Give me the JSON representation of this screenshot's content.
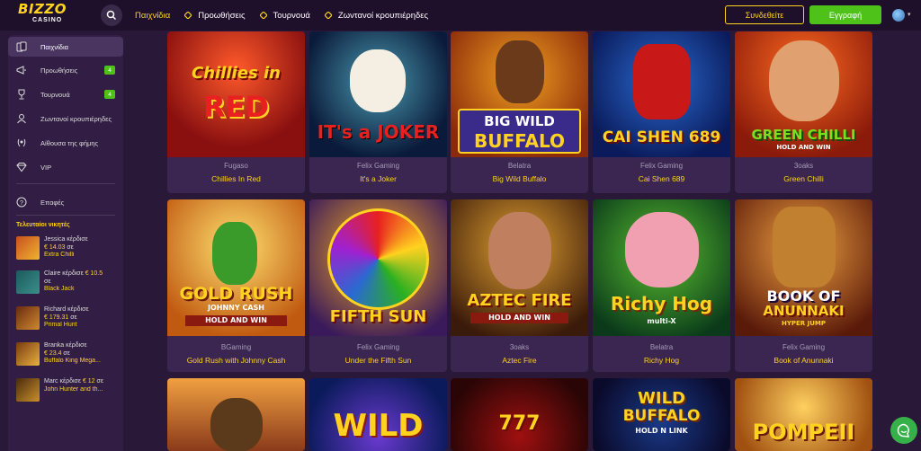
{
  "header": {
    "logo_top": "BIZZO",
    "logo_bottom": "CASINO",
    "nav": [
      "Παιχνίδια",
      "Προωθήσεις",
      "Τουρνουά",
      "Ζωντανοί κρουπιέρηδες"
    ],
    "login_label": "Συνδεθείτε",
    "register_label": "Εγγραφή"
  },
  "sidebar": {
    "items": [
      {
        "label": "Παιχνίδια",
        "icon": "cards-icon"
      },
      {
        "label": "Προωθήσεις",
        "icon": "megaphone-icon",
        "badge": "4"
      },
      {
        "label": "Τουρνουά",
        "icon": "trophy-icon",
        "badge": "4"
      },
      {
        "label": "Ζωντανοί κρουπιέρηδες",
        "icon": "dealer-icon"
      },
      {
        "label": "Αίθουσα της φήμης",
        "icon": "laurel-icon"
      },
      {
        "label": "VIP",
        "icon": "diamond-icon"
      },
      {
        "label": "Επαφές",
        "icon": "help-icon"
      }
    ],
    "winners_title": "Τελευταίοι νικητές",
    "winners": [
      {
        "line1": "Jessica κέρδισε",
        "amount": "€ 14.03",
        "suffix": "σε",
        "game": "Extra Chilli"
      },
      {
        "line1": "Claire κέρδισε",
        "amount": "€ 10.5",
        "suffix": "σε",
        "game": "Black Jack"
      },
      {
        "line1": "Richard κέρδισε",
        "amount": "€ 179.31",
        "suffix": "σε",
        "game": "Primal Hunt"
      },
      {
        "line1": "Branka κέρδισε",
        "amount": "€ 23.4",
        "suffix": "σε",
        "game": "Buffalo King Mega..."
      },
      {
        "line1": "Marc κέρδισε",
        "amount": "€ 12",
        "suffix": "σε",
        "game": "John Hunter and th..."
      }
    ]
  },
  "games": [
    {
      "provider": "Fugaso",
      "name": "Chillies In Red",
      "art": [
        "Chillies in",
        "RED"
      ]
    },
    {
      "provider": "Felix Gaming",
      "name": "It's a Joker",
      "art": [
        "IT's a JOKER"
      ]
    },
    {
      "provider": "Belatra",
      "name": "Big Wild Buffalo",
      "art": [
        "BIG WILD",
        "BUFFALO"
      ]
    },
    {
      "provider": "Felix Gaming",
      "name": "Cai Shen 689",
      "art": [
        "CAI SHEN 689"
      ]
    },
    {
      "provider": "3oaks",
      "name": "Green Chilli",
      "art": [
        "GREEN CHILLI",
        "HOLD AND WIN"
      ]
    },
    {
      "provider": "BGaming",
      "name": "Gold Rush with Johnny Cash",
      "art": [
        "GOLD RUSH",
        "JOHNNY CASH",
        "HOLD AND WIN"
      ]
    },
    {
      "provider": "Felix Gaming",
      "name": "Under the Fifth Sun",
      "art": [
        "FIFTH SUN"
      ]
    },
    {
      "provider": "3oaks",
      "name": "Aztec Fire",
      "art": [
        "AZTEC FIRE",
        "HOLD AND WIN"
      ]
    },
    {
      "provider": "Belatra",
      "name": "Richy Hog",
      "art": [
        "Richy Hog",
        "multi-X"
      ]
    },
    {
      "provider": "Felix Gaming",
      "name": "Book of Anunnaki",
      "art": [
        "BOOK OF",
        "ANUNNAKI",
        "HYPER JUMP"
      ]
    },
    {
      "provider": "",
      "name": "",
      "art": [
        ""
      ]
    },
    {
      "provider": "",
      "name": "",
      "art": [
        "WILD"
      ]
    },
    {
      "provider": "",
      "name": "",
      "art": [
        "777"
      ]
    },
    {
      "provider": "",
      "name": "",
      "art": [
        "WILD",
        "BUFFALO",
        "HOLD N LINK"
      ]
    },
    {
      "provider": "",
      "name": "",
      "art": [
        "POMPEII"
      ]
    }
  ],
  "colors": {
    "accent": "#ffd21f",
    "green": "#4fc21a",
    "bg": "#2a1838",
    "sidebar": "#321e44"
  }
}
